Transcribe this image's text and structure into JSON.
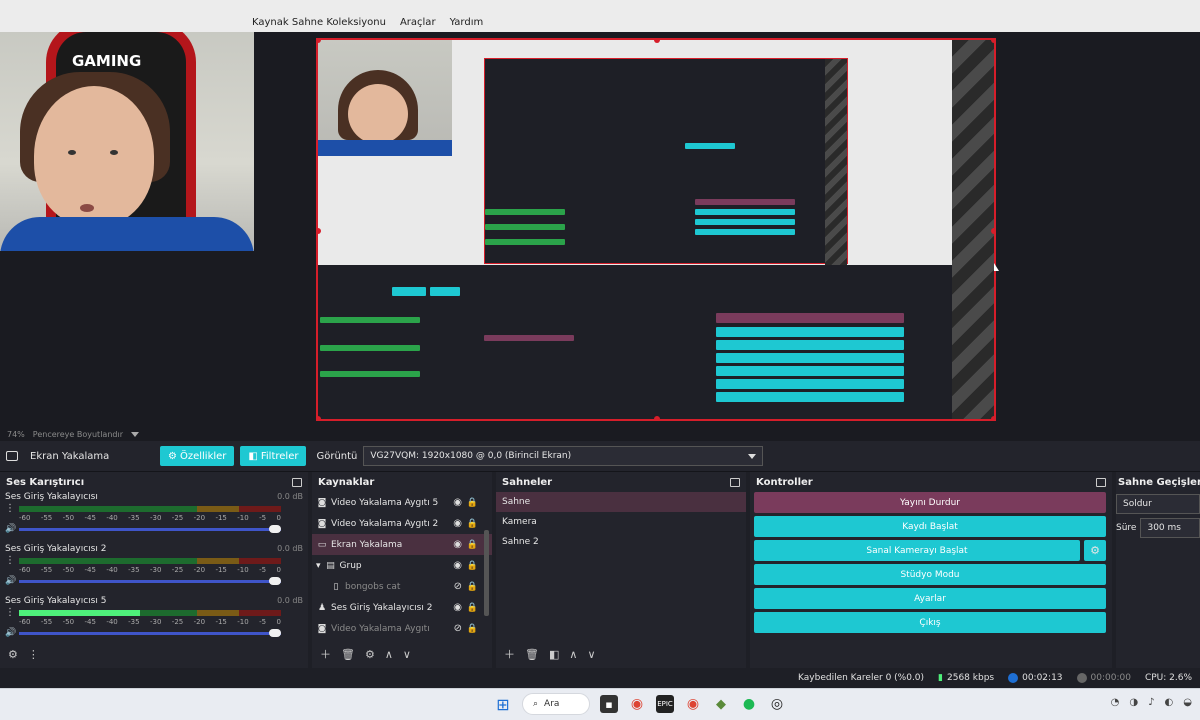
{
  "menu": [
    "Kaynak Sahne Koleksiyonu",
    "Araçlar",
    "Yardım"
  ],
  "webcam": {
    "chair_text": "GAMING"
  },
  "zoom": {
    "percent": "74%",
    "label": "Pencereye Boyutlandır"
  },
  "source_toolbar": {
    "source_name": "Ekran Yakalama",
    "properties_label": "Özellikler",
    "filters_label": "Filtreler",
    "display_label": "Görüntü",
    "display_value": "VG27VQM: 1920x1080 @ 0,0 (Birincil Ekran)"
  },
  "mixer": {
    "title": "Ses Karıştırıcı",
    "channels": [
      {
        "name": "Ses Giriş Yakalayıcısı",
        "db": "0.0 dB",
        "level": 0.0
      },
      {
        "name": "Ses Giriş Yakalayıcısı 2",
        "db": "0.0 dB",
        "level": 0.0
      },
      {
        "name": "Ses Giriş Yakalayıcısı 5",
        "db": "0.0 dB",
        "level": 0.46
      }
    ],
    "scale": [
      "-60",
      "-55",
      "-50",
      "-45",
      "-40",
      "-35",
      "-30",
      "-25",
      "-20",
      "-15",
      "-10",
      "-5",
      "0"
    ]
  },
  "sources": {
    "title": "Kaynaklar",
    "items": [
      {
        "label": "Video Yakalama Aygıtı 5",
        "icon": "camera-icon"
      },
      {
        "label": "Video Yakalama Aygıtı 2",
        "icon": "camera-icon"
      },
      {
        "label": "Ekran Yakalama",
        "icon": "monitor-icon",
        "selected": true
      },
      {
        "label": "Grup",
        "icon": "folder-icon"
      },
      {
        "label": "bongobs cat",
        "icon": "file-icon",
        "hidden": true
      },
      {
        "label": "Ses Giriş Yakalayıcısı 2",
        "icon": "mic-icon"
      },
      {
        "label": "Video Yakalama Aygıtı",
        "icon": "camera-icon",
        "hidden": true
      }
    ]
  },
  "scenes": {
    "title": "Sahneler",
    "items": [
      "Sahne",
      "Kamera",
      "Sahne 2"
    ]
  },
  "controls": {
    "title": "Kontroller",
    "stop_stream": "Yayını Durdur",
    "start_record": "Kaydı Başlat",
    "virtual_cam": "Sanal Kamerayı Başlat",
    "studio_mode": "Stüdyo Modu",
    "settings": "Ayarlar",
    "exit": "Çıkış"
  },
  "transitions": {
    "title": "Sahne Geçişleri",
    "type": "Soldur",
    "duration_label": "Süre",
    "duration": "300 ms"
  },
  "status": {
    "dropped": "Kaybedilen Kareler 0 (%0.0)",
    "bitrate": "2568 kbps",
    "stream_time": "00:02:13",
    "record_time": "00:00:00",
    "cpu": "CPU: 2.6%"
  },
  "taskbar": {
    "search": "Ara"
  },
  "colors": {
    "accent": "#1ec8d2",
    "active": "#7a3b5c",
    "border_red": "#d61e2a"
  }
}
